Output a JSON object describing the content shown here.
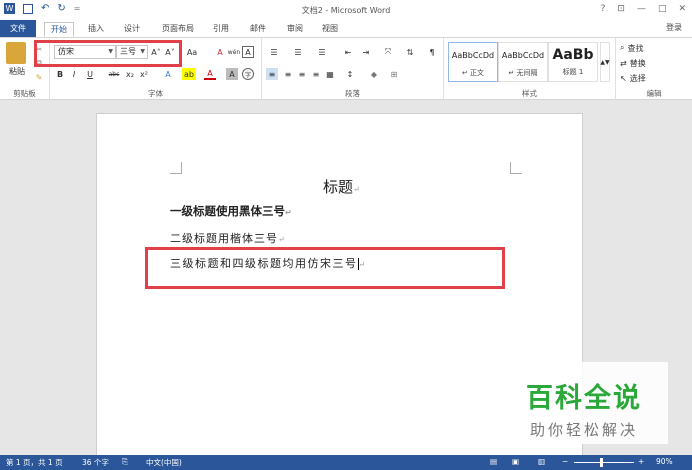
{
  "window": {
    "title": "文档2 - Microsoft Word",
    "help": "?",
    "restore": "⊡",
    "minimize": "—",
    "maximize": "□",
    "close": "✕"
  },
  "qat": {
    "word_icon": "W",
    "save_icon": "💾",
    "undo_icon": "↶",
    "redo_icon": "↻",
    "more": "="
  },
  "tabs": {
    "file": "文件",
    "items": [
      "开始",
      "插入",
      "设计",
      "页面布局",
      "引用",
      "邮件",
      "审阅",
      "视图"
    ],
    "login": "登录"
  },
  "ribbon": {
    "clipboard": {
      "paste": "粘贴",
      "label": "剪贴板"
    },
    "font": {
      "name": "仿宋",
      "size": "三号",
      "grow": "A˄",
      "shrink": "A˅",
      "case": "Aa",
      "clear": "A",
      "pinyin": "wén",
      "border": "A",
      "bold": "B",
      "italic": "I",
      "underline": "U",
      "strike": "abc",
      "sub": "x₂",
      "sup": "x²",
      "effects": "A",
      "highlight": "ab",
      "color": "A",
      "shade": "A",
      "circle": "字",
      "label": "字体"
    },
    "paragraph": {
      "label": "段落"
    },
    "styles": {
      "label": "样式",
      "items": [
        {
          "preview": "AaBbCcDd",
          "name": "↵ 正文"
        },
        {
          "preview": "AaBbCcDd",
          "name": "↵ 无间隔"
        },
        {
          "preview": "AaBb",
          "name": "标题 1"
        }
      ]
    },
    "editing": {
      "find": "查找",
      "replace": "替换",
      "select": "选择",
      "label": "编辑"
    }
  },
  "document": {
    "title": "标题",
    "line1": "一级标题使用黑体三号",
    "line2": "二级标题用楷体三号",
    "line3": "三级标题和四级标题均用仿宋三号",
    "para_mark": "↵"
  },
  "status": {
    "page": "第 1 页，共 1 页",
    "words": "36 个字",
    "lang": "中文(中国)",
    "zoom": "90%"
  },
  "watermark": {
    "big": "百科全说",
    "small": "助你轻松解决"
  }
}
